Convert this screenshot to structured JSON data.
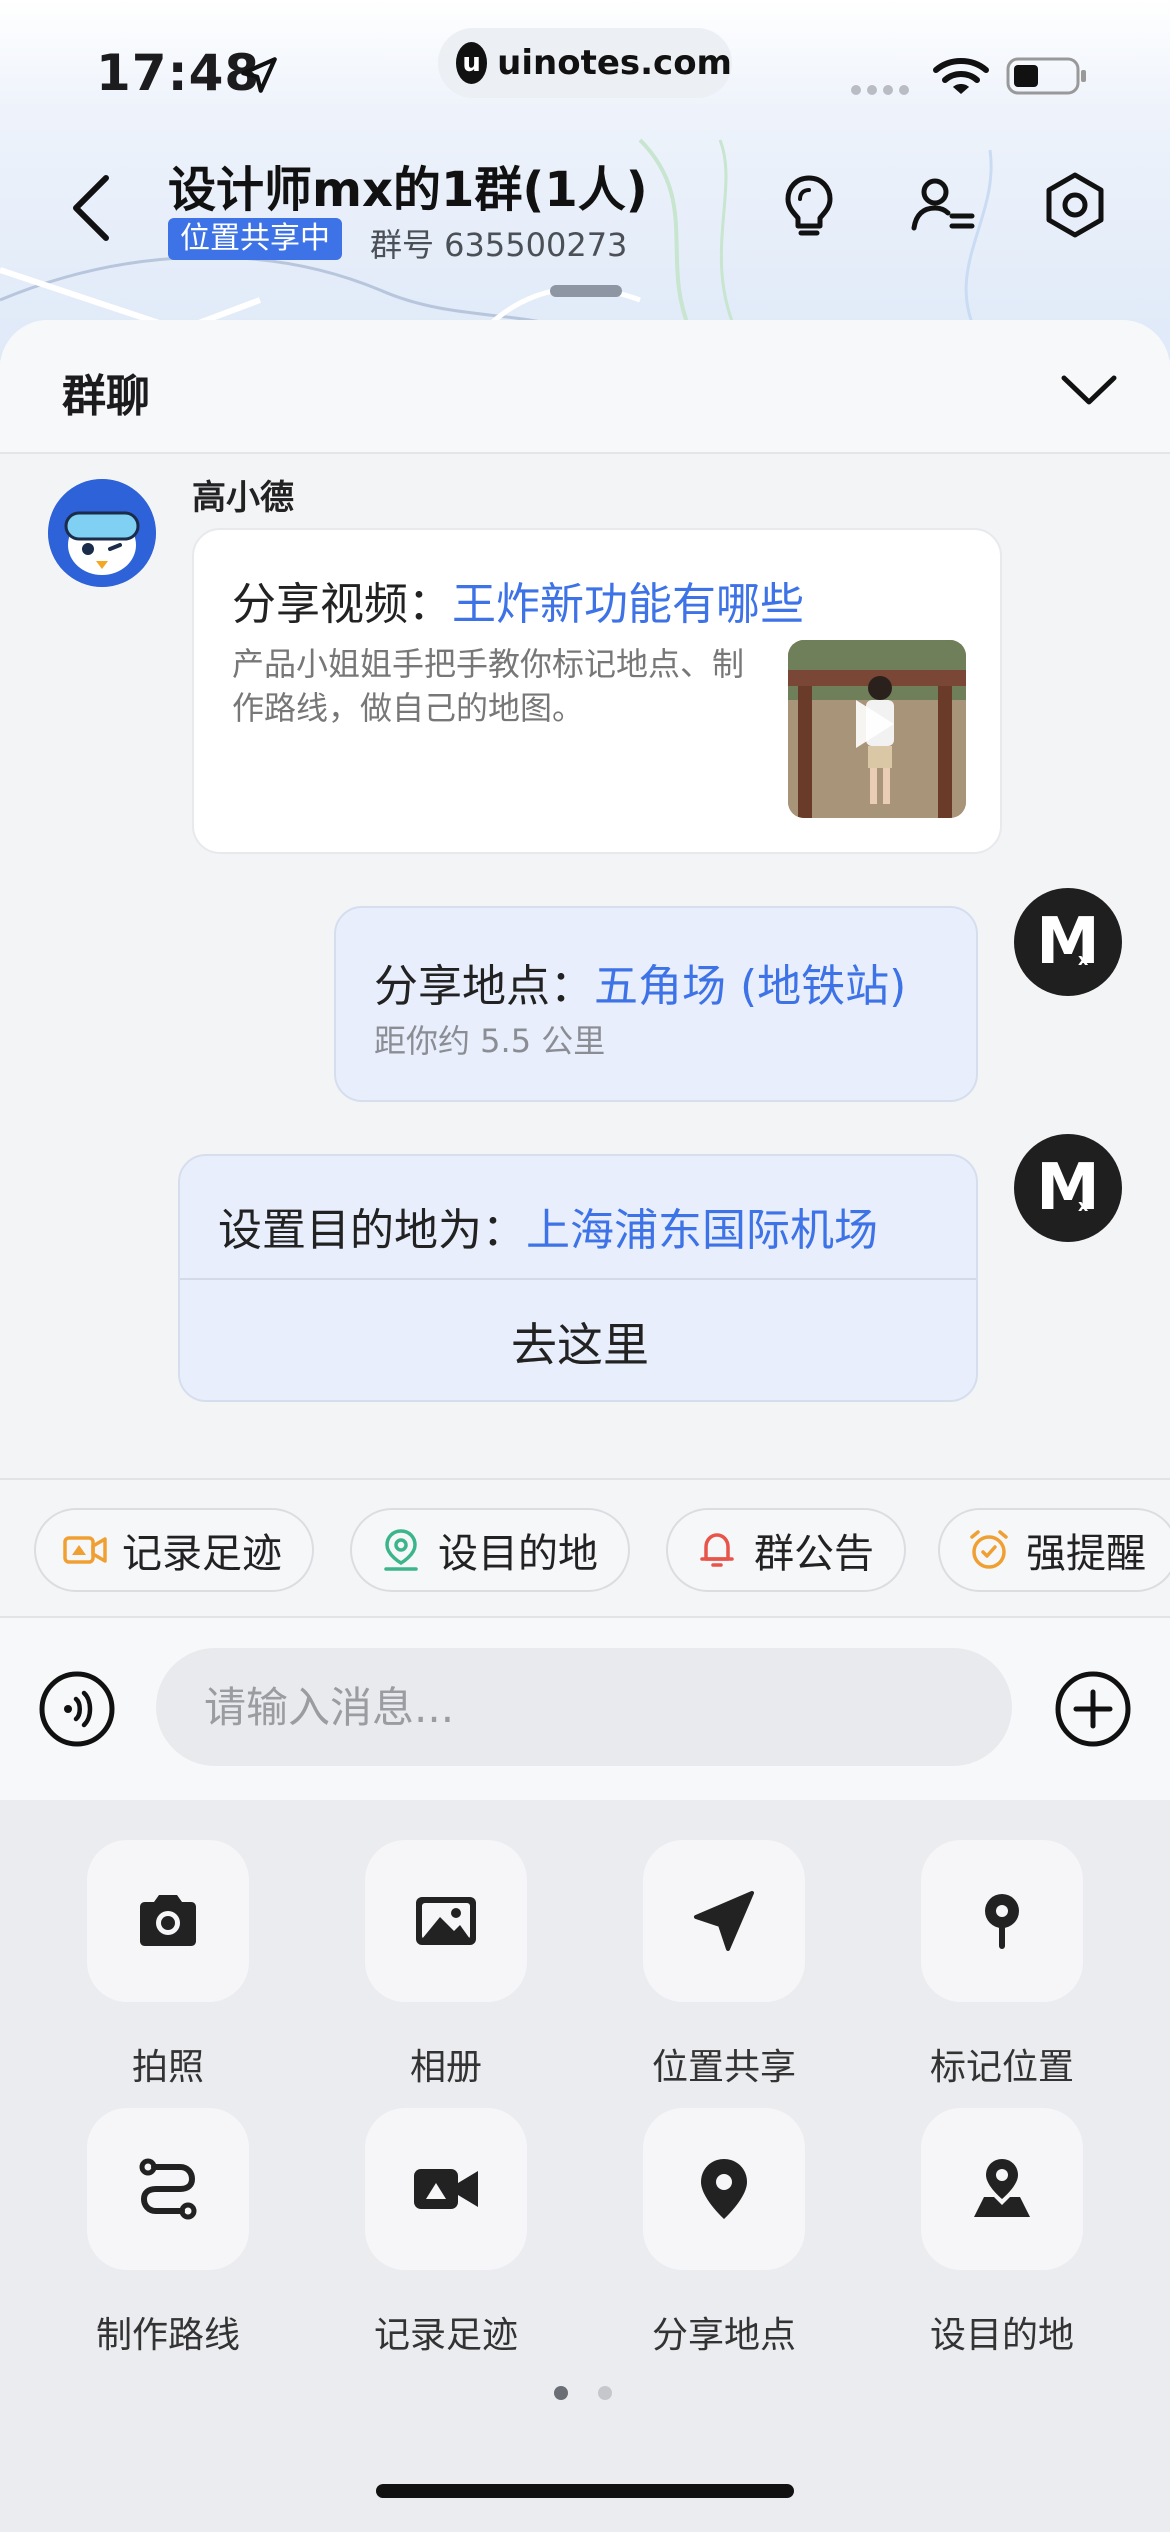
{
  "status_bar": {
    "time": "17:48",
    "url": "uinotes.com"
  },
  "header": {
    "title": "设计师mx的1群(1人)",
    "location_badge": "位置共享中",
    "group_number": "群号 635500273"
  },
  "sheet": {
    "title": "群聊"
  },
  "messages": [
    {
      "sender": "高小德",
      "prefix": "分享视频：",
      "link": "王炸新功能有哪些",
      "description": "产品小姐姐手把手教你标记地点、制作路线，做自己的地图。"
    },
    {
      "prefix": "分享地点：",
      "link": "五角场 (地铁站)",
      "distance": "距你约 5.5 公里"
    },
    {
      "prefix": "设置目的地为：",
      "link": "上海浦东国际机场",
      "action": "去这里"
    }
  ],
  "chips": [
    {
      "label": "记录足迹",
      "icon": "video-camera-icon",
      "color": "#f0a032"
    },
    {
      "label": "设目的地",
      "icon": "location-pin-icon",
      "color": "#3cb58a"
    },
    {
      "label": "群公告",
      "icon": "bell-icon",
      "color": "#e8534a"
    },
    {
      "label": "强提醒",
      "icon": "alarm-clock-icon",
      "color": "#f0a032"
    }
  ],
  "input": {
    "placeholder": "请输入消息..."
  },
  "tools": [
    {
      "label": "拍照",
      "icon": "camera-icon"
    },
    {
      "label": "相册",
      "icon": "photo-album-icon"
    },
    {
      "label": "位置共享",
      "icon": "navigation-arrow-icon"
    },
    {
      "label": "标记位置",
      "icon": "map-marker-icon"
    },
    {
      "label": "制作路线",
      "icon": "route-icon"
    },
    {
      "label": "记录足迹",
      "icon": "video-camera-icon"
    },
    {
      "label": "分享地点",
      "icon": "location-pin-icon"
    },
    {
      "label": "设目的地",
      "icon": "person-pin-icon"
    }
  ],
  "pager": {
    "pages": 2,
    "current": 1
  },
  "colors": {
    "accent": "#3d73e6",
    "bubble_self": "#e8eefb"
  }
}
